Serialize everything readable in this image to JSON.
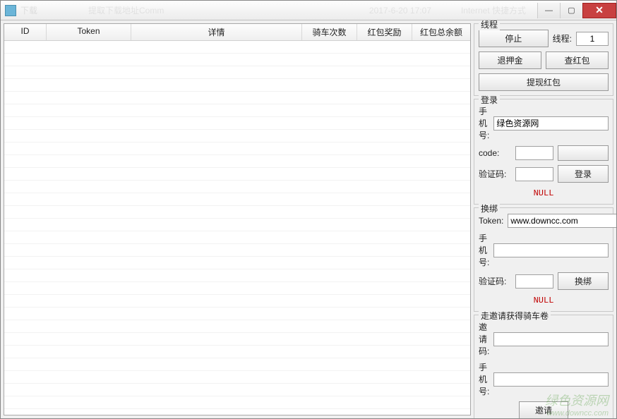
{
  "titlebar": {
    "icon_label": "易",
    "faded1": "下载",
    "faded2": "提取下载地址Comm",
    "faded3": "2017-6-20 17:07",
    "faded4": "Internet 快捷方式"
  },
  "table": {
    "headers": {
      "id": "ID",
      "token": "Token",
      "detail": "详情",
      "rides": "骑车次数",
      "reward": "红包奖励",
      "balance": "红包总余额"
    }
  },
  "thread": {
    "title": "线程",
    "stop": "停止",
    "thread_label": "线程:",
    "thread_value": "1",
    "refund": "退押金",
    "check": "查红包",
    "withdraw": "提现红包"
  },
  "login": {
    "title": "登录",
    "phone_label": "手机号:",
    "phone_value": "绿色资源网",
    "code_label": "code:",
    "code_value": "",
    "captcha_label": "验证码:",
    "captcha_value": "",
    "login_btn": "登录",
    "status": "NULL"
  },
  "rebind": {
    "title": "换绑",
    "token_label": "Token:",
    "token_value": "www.downcc.com",
    "phone_label": "手机号:",
    "phone_value": "",
    "captcha_label": "验证码:",
    "captcha_value": "",
    "rebind_btn": "换绑",
    "status": "NULL"
  },
  "invite": {
    "title": "走邀请获得骑车卷",
    "code_label": "邀请码:",
    "code_value": "",
    "phone_label": "手机号:",
    "phone_value": "",
    "invite_btn": "邀请"
  },
  "watermark": {
    "text": "绿色资源网",
    "sub": "www.downcc.com"
  }
}
